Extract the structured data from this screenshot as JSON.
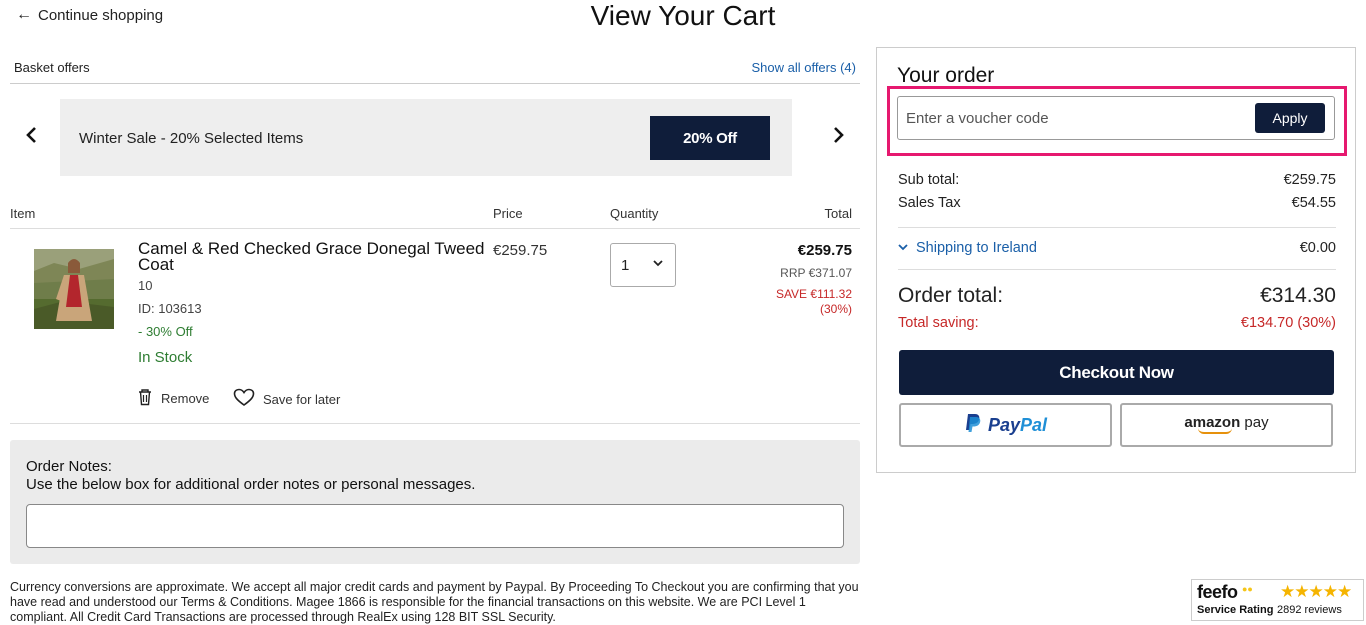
{
  "header": {
    "continue_label": "Continue shopping",
    "page_title": "View Your Cart"
  },
  "offers": {
    "label": "Basket offers",
    "show_all": "Show all offers (4)",
    "current_offer": "Winter Sale - 20% Selected Items",
    "offer_button": "20% Off"
  },
  "table": {
    "col_item": "Item",
    "col_price": "Price",
    "col_quantity": "Quantity",
    "col_total": "Total"
  },
  "item": {
    "name": "Camel & Red Checked Grace Donegal Tweed Coat",
    "size": "10",
    "id": "ID: 103613",
    "discount": "- 30% Off",
    "stock": "In Stock",
    "price": "€259.75",
    "quantity": "1",
    "total": "€259.75",
    "rrp": "RRP €371.07",
    "save": "SAVE €111.32",
    "save_pct": "(30%)",
    "remove_label": "Remove",
    "save_later_label": "Save for later"
  },
  "notes": {
    "title": "Order Notes:",
    "subtitle": "Use the below box for additional order notes or personal messages."
  },
  "disclaimer": "Currency conversions are approximate. We accept all major credit cards and payment by Paypal. By Proceeding To Checkout you are confirming that you have read and understood our Terms & Conditions. Magee 1866 is responsible for the financial transactions on this website. We are PCI Level 1 compliant. All Credit Card Transactions are processed through RealEx using 128 BIT SSL Security.",
  "summary": {
    "title": "Your order",
    "voucher_placeholder": "Enter a voucher code",
    "apply_label": "Apply",
    "subtotal_label": "Sub total:",
    "subtotal_value": "€259.75",
    "tax_label": "Sales Tax",
    "tax_value": "€54.55",
    "shipping_label": "Shipping to Ireland",
    "shipping_value": "€0.00",
    "order_total_label": "Order total:",
    "order_total_value": "€314.30",
    "saving_label": "Total saving:",
    "saving_value": "€134.70 (30%)",
    "checkout_label": "Checkout Now",
    "paypal_label_1": "Pay",
    "paypal_label_2": "Pal",
    "amazon_label_1": "amazon",
    "amazon_label_2": " pay"
  },
  "feefo": {
    "logo": "feefo",
    "label": "Service Rating",
    "stars": "★★★★★",
    "reviews": "2892 reviews",
    "rating_stars": 5
  },
  "colors": {
    "navy": "#0f1d3a",
    "link_blue": "#1a5fa8",
    "highlight_pink": "#e6186f",
    "sale_red": "#c62828",
    "stock_green": "#2e7d32"
  },
  "icons": {
    "back": "arrow-left-icon",
    "prev": "chevron-left-icon",
    "next": "chevron-right-icon",
    "quantity": "chevron-down-icon",
    "remove": "trash-icon",
    "save": "heart-icon",
    "shipping": "chevron-down-icon"
  }
}
